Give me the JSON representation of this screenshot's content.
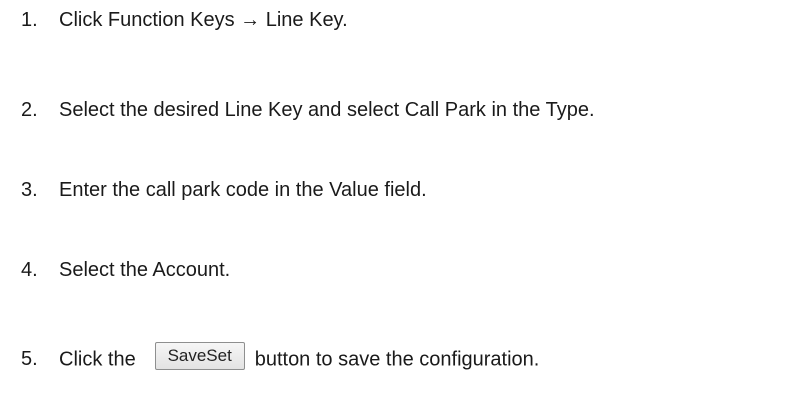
{
  "steps": [
    {
      "number": "1.",
      "text": "Click Function Keys → Line Key."
    },
    {
      "number": "2.",
      "text": "Select the desired Line Key and select Call Park in the Type."
    },
    {
      "number": "3.",
      "text": "Enter the call park code in the Value field."
    },
    {
      "number": "4.",
      "text": "Select the Account."
    },
    {
      "number": "5.",
      "text_before": "Click the",
      "button_label": "SaveSet",
      "text_after": "button to save the configuration."
    }
  ]
}
